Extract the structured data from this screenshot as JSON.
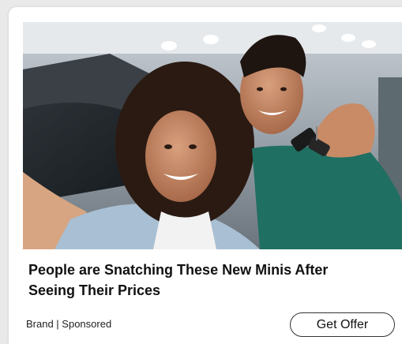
{
  "ad": {
    "headline": "People are Snatching These New Minis After Seeing Their Prices",
    "brand_label": "Brand | Sponsored",
    "cta_label": "Get Offer",
    "image_icon": "photo-of-couple-with-car-keys"
  },
  "colors": {
    "background": "#e9e9e9",
    "card": "#ffffff",
    "text": "#111111",
    "button_border": "#333333"
  }
}
